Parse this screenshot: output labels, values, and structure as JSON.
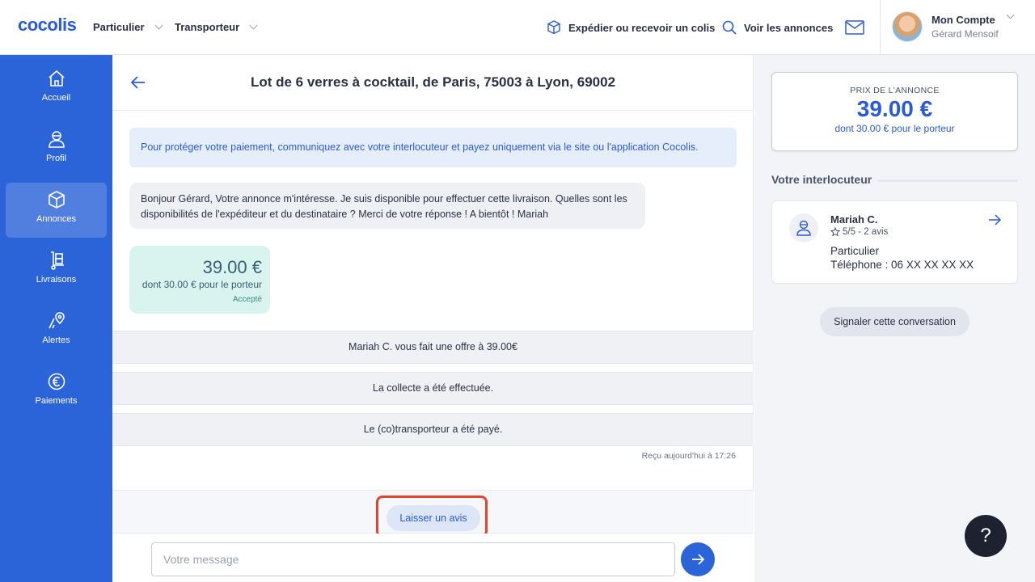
{
  "brand": {
    "logo": "cocolis",
    "accent": "#2b63d9"
  },
  "topbar": {
    "nav": [
      {
        "label": "Particulier"
      },
      {
        "label": "Transporteur"
      }
    ],
    "ship_label": "Expédier ou recevoir un colis",
    "ads_label": "Voir les annonces",
    "account_title": "Mon Compte",
    "account_name": "Gérard Mensoif"
  },
  "sidebar": {
    "items": [
      {
        "label": "Accueil",
        "icon": "home-icon"
      },
      {
        "label": "Profil",
        "icon": "user-icon"
      },
      {
        "label": "Annonces",
        "icon": "box-icon",
        "active": true
      },
      {
        "label": "Livraisons",
        "icon": "delivery-icon"
      },
      {
        "label": "Alertes",
        "icon": "pin-icon"
      },
      {
        "label": "Paiements",
        "icon": "euro-icon"
      }
    ]
  },
  "conversation": {
    "title": "Lot de 6 verres à cocktail, de Paris, 75003 à Lyon, 69002",
    "notice": "Pour protéger votre paiement, communiquez avec votre interlocuteur et payez uniquement via le site ou l'application Cocolis.",
    "message": "Bonjour Gérard, Votre annonce m'intéresse. Je suis disponible pour effectuer cette livraison. Quelles sont les disponibilités de l'expéditeur et du destinataire ? Merci de votre réponse ! A bientôt ! Mariah",
    "offer": {
      "price": "39.00 €",
      "detail": "dont 30.00 € pour le porteur",
      "status": "Accepté"
    },
    "events": [
      "Mariah C. vous fait une offre à 39.00€",
      "La collecte a été effectuée.",
      "Le (co)transporteur a été payé."
    ],
    "received": "Reçu aujourd'hui à 17:26",
    "review_button": "Laisser un avis",
    "input_placeholder": "Votre message"
  },
  "sidepanel": {
    "price_label": "PRIX DE L'ANNONCE",
    "price_value": "39.00 €",
    "price_detail": "dont 30.00 € pour le porteur",
    "section_title": "Votre interlocuteur",
    "contact": {
      "name": "Mariah C.",
      "rating": "5/5 - 2 avis",
      "type": "Particulier",
      "phone": "Téléphone : 06 XX XX XX XX"
    },
    "report_button": "Signaler cette conversation"
  },
  "help": {
    "label": "?"
  }
}
